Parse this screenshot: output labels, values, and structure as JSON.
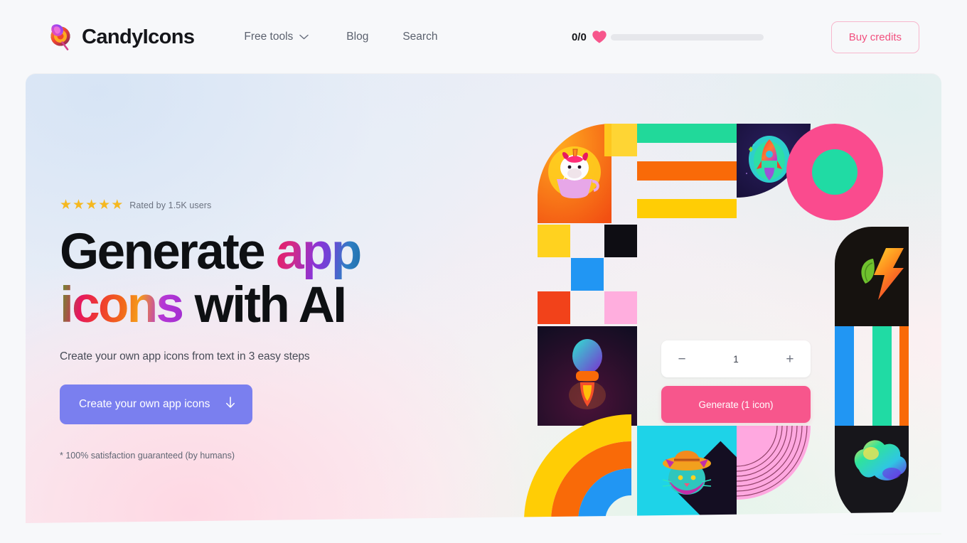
{
  "header": {
    "brand_name": "CandyIcons",
    "logo_icon": "candy-lollipop-logo",
    "nav": [
      {
        "label": "Free tools",
        "icon": "chevron-down-icon",
        "has_dropdown": true
      },
      {
        "label": "Blog",
        "has_dropdown": false
      },
      {
        "label": "Search",
        "has_dropdown": false
      }
    ],
    "credits": {
      "count_label": "0/0",
      "icon": "heart-icon",
      "progress_percent": 0
    },
    "buy_button_label": "Buy credits"
  },
  "hero": {
    "rating": {
      "stars": 5,
      "star_glyph": "★",
      "text": "Rated by 1.5K users"
    },
    "headline": {
      "line1_plain": "Generate ",
      "line1_gradient": "app",
      "line2_gradient": "icons",
      "line2_plain": " with AI"
    },
    "subtitle": "Create your own app icons from text in 3 easy steps",
    "cta": {
      "label": "Create your own app icons",
      "icon": "arrow-down-icon"
    },
    "note": "* 100% satisfaction guaranteed (by humans)"
  },
  "generator_widget": {
    "decrement_label": "−",
    "quantity_value": "1",
    "increment_label": "+",
    "generate_label": "Generate (1 icon)"
  },
  "colors": {
    "brand_pink": "#f7568c",
    "buy_border": "#f7b7cd",
    "buy_text": "#f2507f",
    "cta_purple": "#7a7fef",
    "star_gold": "#f5b820",
    "page_bg": "#f7f8fa"
  },
  "collage": {
    "icon_tiles": [
      {
        "name": "unicorn-cup-icon",
        "description": "unicorn in a teacup on orange quarter circle"
      },
      {
        "name": "rocket-icon",
        "description": "neon rocket on dark navy space tile"
      },
      {
        "name": "leaf-bolt-icon",
        "description": "green leaf with lightning bolt on black tile"
      },
      {
        "name": "bulb-rocket-icon",
        "description": "teal bulb rocket on dark tile"
      },
      {
        "name": "cat-hat-icon",
        "description": "neon cat with hat on cyan tile"
      },
      {
        "name": "gradient-blob-icon",
        "description": "gradient blob on black tile"
      }
    ],
    "shape_tiles": [
      {
        "name": "pink-donut-shape"
      },
      {
        "name": "rainbow-arc-shape"
      },
      {
        "name": "pink-quarter-arc-shape"
      },
      {
        "name": "horizontal-stripes"
      },
      {
        "name": "vertical-stripes"
      },
      {
        "name": "color-squares"
      }
    ]
  }
}
